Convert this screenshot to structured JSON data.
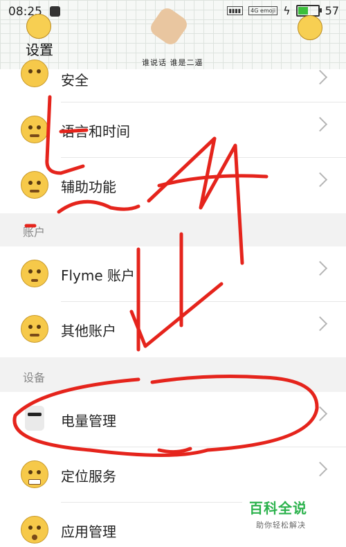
{
  "status_bar": {
    "time": "08:25",
    "network_label": "4G",
    "emoji_label": "emoji",
    "battery_level": "57",
    "battery_fraction": 0.57
  },
  "header": {
    "title": "设置",
    "sticker_caption": "谁说话   谁是二逼"
  },
  "list": {
    "rows": [
      {
        "label": "安全",
        "icon": "smiley-icon"
      },
      {
        "label": "语言和时间",
        "icon": "blushing-face-icon"
      },
      {
        "label": "辅助功能",
        "icon": "crying-face-icon"
      },
      {
        "label": "Flyme 账户",
        "icon": "worried-face-icon"
      },
      {
        "label": "其他账户",
        "icon": "angry-face-icon"
      },
      {
        "label": "电量管理",
        "icon": "cool-sticker-icon"
      },
      {
        "label": "定位服务",
        "icon": "grimace-face-icon"
      },
      {
        "label": "应用管理",
        "icon": "surprised-face-icon"
      }
    ],
    "sections": [
      {
        "label": "账户"
      },
      {
        "label": "设备"
      }
    ]
  },
  "watermark": {
    "title": "百科全说",
    "subtitle": "助你轻松解决"
  },
  "colors": {
    "annotation": "#e5241c",
    "watermark": "#2bb24c"
  }
}
